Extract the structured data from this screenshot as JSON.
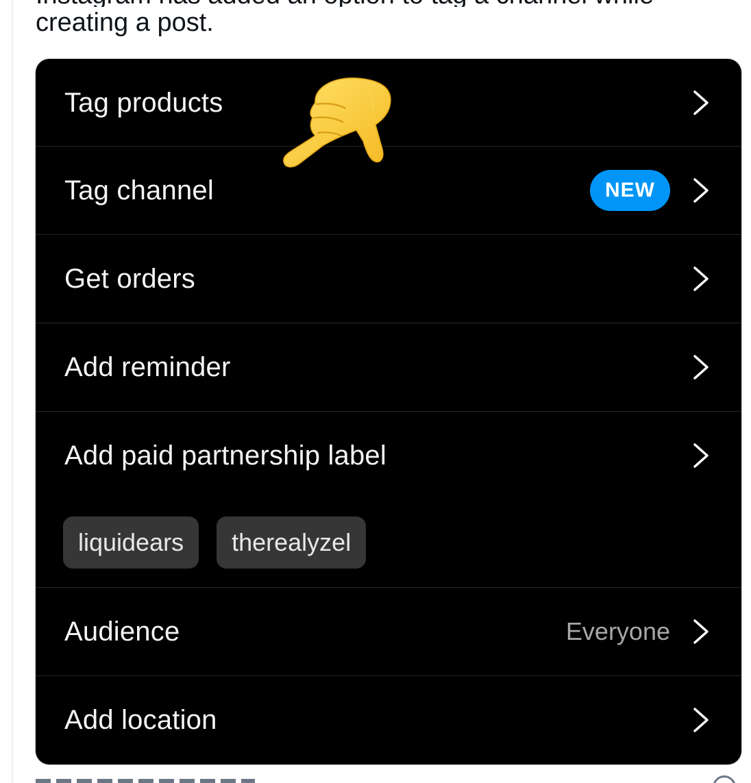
{
  "tweet": {
    "text_line_1": "Instagram has added an option to tag a channel while",
    "text_line_2": "creating a post."
  },
  "menu": {
    "rows": [
      {
        "label": "Tag products"
      },
      {
        "label": "Tag channel",
        "badge": "NEW"
      },
      {
        "label": "Get orders"
      },
      {
        "label": "Add reminder"
      },
      {
        "label": "Add paid partnership label"
      },
      {
        "label": "Audience",
        "value": "Everyone"
      },
      {
        "label": "Add location"
      }
    ],
    "chips": [
      "liquidears",
      "therealyzel"
    ]
  },
  "icons": {
    "chevron": "chevron-right-icon",
    "emoji": "backhand-index-pointing-down-emoji",
    "info": "info-icon"
  },
  "colors": {
    "card_bg": "#000000",
    "badge_bg": "#0095f6",
    "chip_bg": "#363636",
    "secondary_text": "#a8a8a8"
  }
}
